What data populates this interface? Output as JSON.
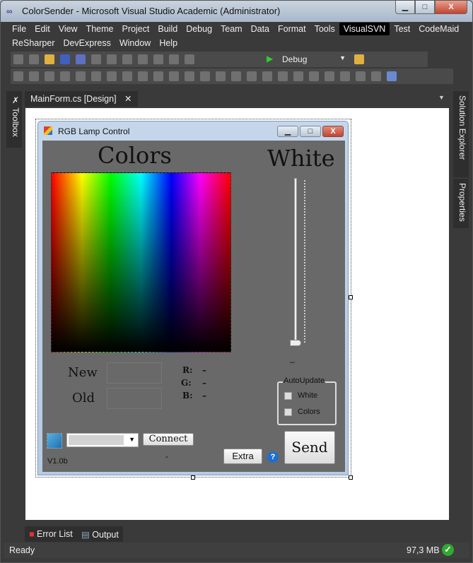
{
  "window": {
    "title": "ColorSender - Microsoft Visual Studio Academic (Administrator)",
    "min": "▁",
    "max": "□",
    "close": "X"
  },
  "menu": {
    "row1": [
      "File",
      "Edit",
      "View",
      "Theme",
      "Project",
      "Build",
      "Debug",
      "Team",
      "Data",
      "Format",
      "Tools",
      "VisualSVN",
      "Test",
      "CodeMaid"
    ],
    "row2": [
      "ReSharper",
      "DevExpress",
      "Window",
      "Help"
    ],
    "selected": "VisualSVN"
  },
  "toolbar": {
    "config": "Debug"
  },
  "tab": {
    "label": "MainForm.cs [Design]",
    "close": "✕"
  },
  "side": {
    "left": "Toolbox",
    "right1": "Solution Explorer",
    "right2": "Properties"
  },
  "form": {
    "title": "RGB Lamp Control",
    "colors_heading": "Colors",
    "white_heading": "White",
    "white_value": "–",
    "new_label": "New",
    "old_label": "Old",
    "r_label": "R:",
    "g_label": "G:",
    "b_label": "B:",
    "r_value": "–",
    "g_value": "–",
    "b_value": "–",
    "autoupdate": "AutoUpdate",
    "chk_white": "White",
    "chk_colors": "Colors",
    "connect": "Connect",
    "send": "Send",
    "extra": "Extra",
    "help": "?",
    "version": "V1.0b",
    "status": "-",
    "white_slider_level": 0
  },
  "bottom_tabs": [
    "Error List",
    "Output"
  ],
  "status": {
    "text": "Ready",
    "memory": "97,3 MB"
  },
  "colors": {
    "accent": "#000000",
    "client": "#696969"
  }
}
